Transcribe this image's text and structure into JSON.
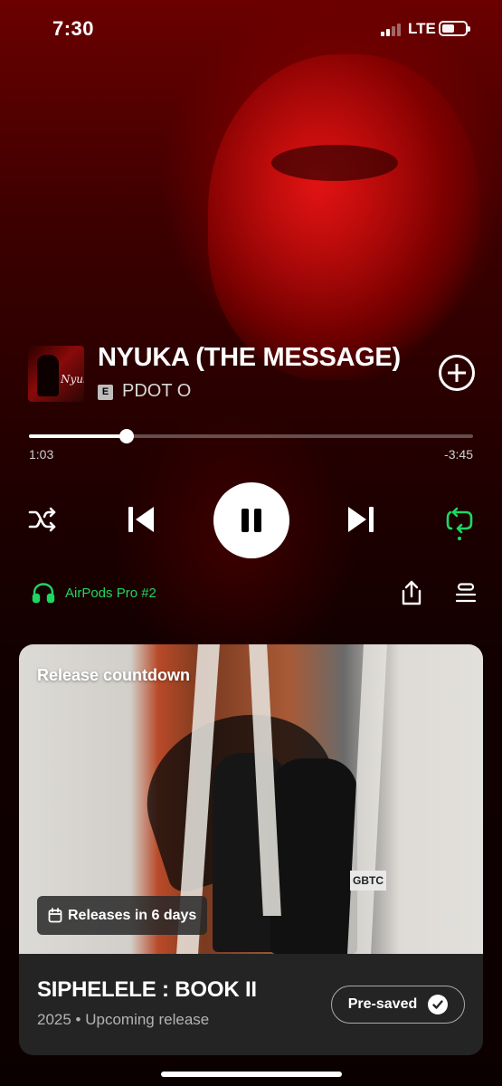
{
  "status_bar": {
    "time": "7:30",
    "network": "LTE",
    "battery_level": 0.4
  },
  "track": {
    "title": "NYUKA (THE MESSAGE)",
    "explicit_badge": "E",
    "artist": "PDOT O",
    "cover_text": "Nyuka",
    "progress": 0.22,
    "elapsed": "1:03",
    "remaining": "-3:45"
  },
  "controls": {
    "shuffle_icon": "shuffle-icon",
    "previous_icon": "skip-previous-icon",
    "play_pause_icon": "pause-icon",
    "next_icon": "skip-next-icon",
    "repeat_icon": "repeat-icon",
    "add_icon": "plus-circle-icon",
    "accent_color": "#1ed760"
  },
  "device": {
    "name": "AirPods Pro #2",
    "icon": "headphones-icon"
  },
  "actions": {
    "share_icon": "share-icon",
    "queue_icon": "queue-icon"
  },
  "countdown_card": {
    "heading": "Release countdown",
    "release_chip": "Releases in 6 days",
    "release_icon": "calendar-icon",
    "album_title": "SIPHELELE : BOOK II",
    "album_subtitle": "2025 • Upcoming release",
    "presave_label": "Pre-saved",
    "presave_icon": "check-circle-icon",
    "image_text": "GBTC"
  }
}
